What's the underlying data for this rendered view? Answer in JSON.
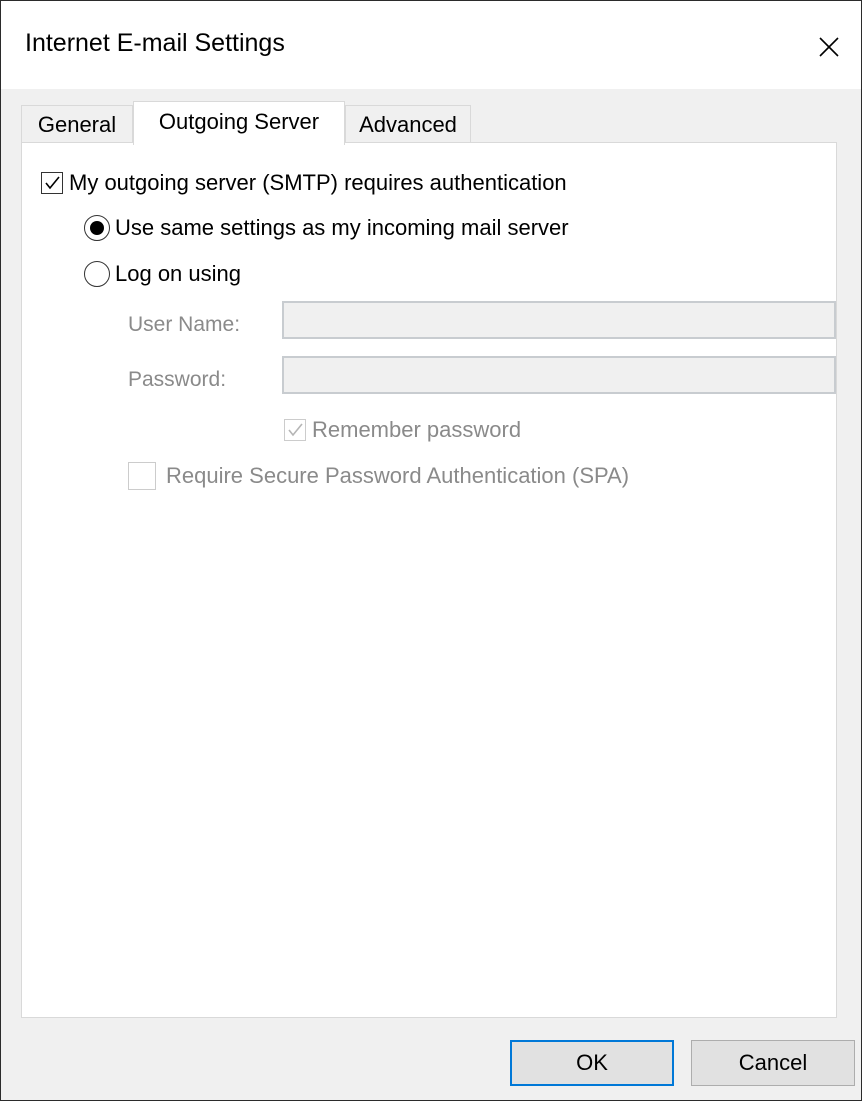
{
  "window": {
    "title": "Internet E-mail Settings"
  },
  "tabs": [
    {
      "label": "General",
      "active": false
    },
    {
      "label": "Outgoing Server",
      "active": true
    },
    {
      "label": "Advanced",
      "active": false
    }
  ],
  "outgoing": {
    "requires_auth_label": "My outgoing server (SMTP) requires authentication",
    "requires_auth_checked": true,
    "same_settings_label": "Use same settings as my incoming mail server",
    "same_settings_selected": true,
    "log_on_label": "Log on using",
    "log_on_selected": false,
    "username_label": "User Name:",
    "username_value": "",
    "password_label": "Password:",
    "password_value": "",
    "remember_password_label": "Remember password",
    "remember_password_checked": true,
    "spa_label": "Require Secure Password Authentication (SPA)",
    "spa_checked": false
  },
  "buttons": {
    "ok_label": "OK",
    "cancel_label": "Cancel"
  },
  "colors": {
    "accent": "#0078d7",
    "panel": "#ffffff",
    "chrome": "#f0f0f0"
  }
}
